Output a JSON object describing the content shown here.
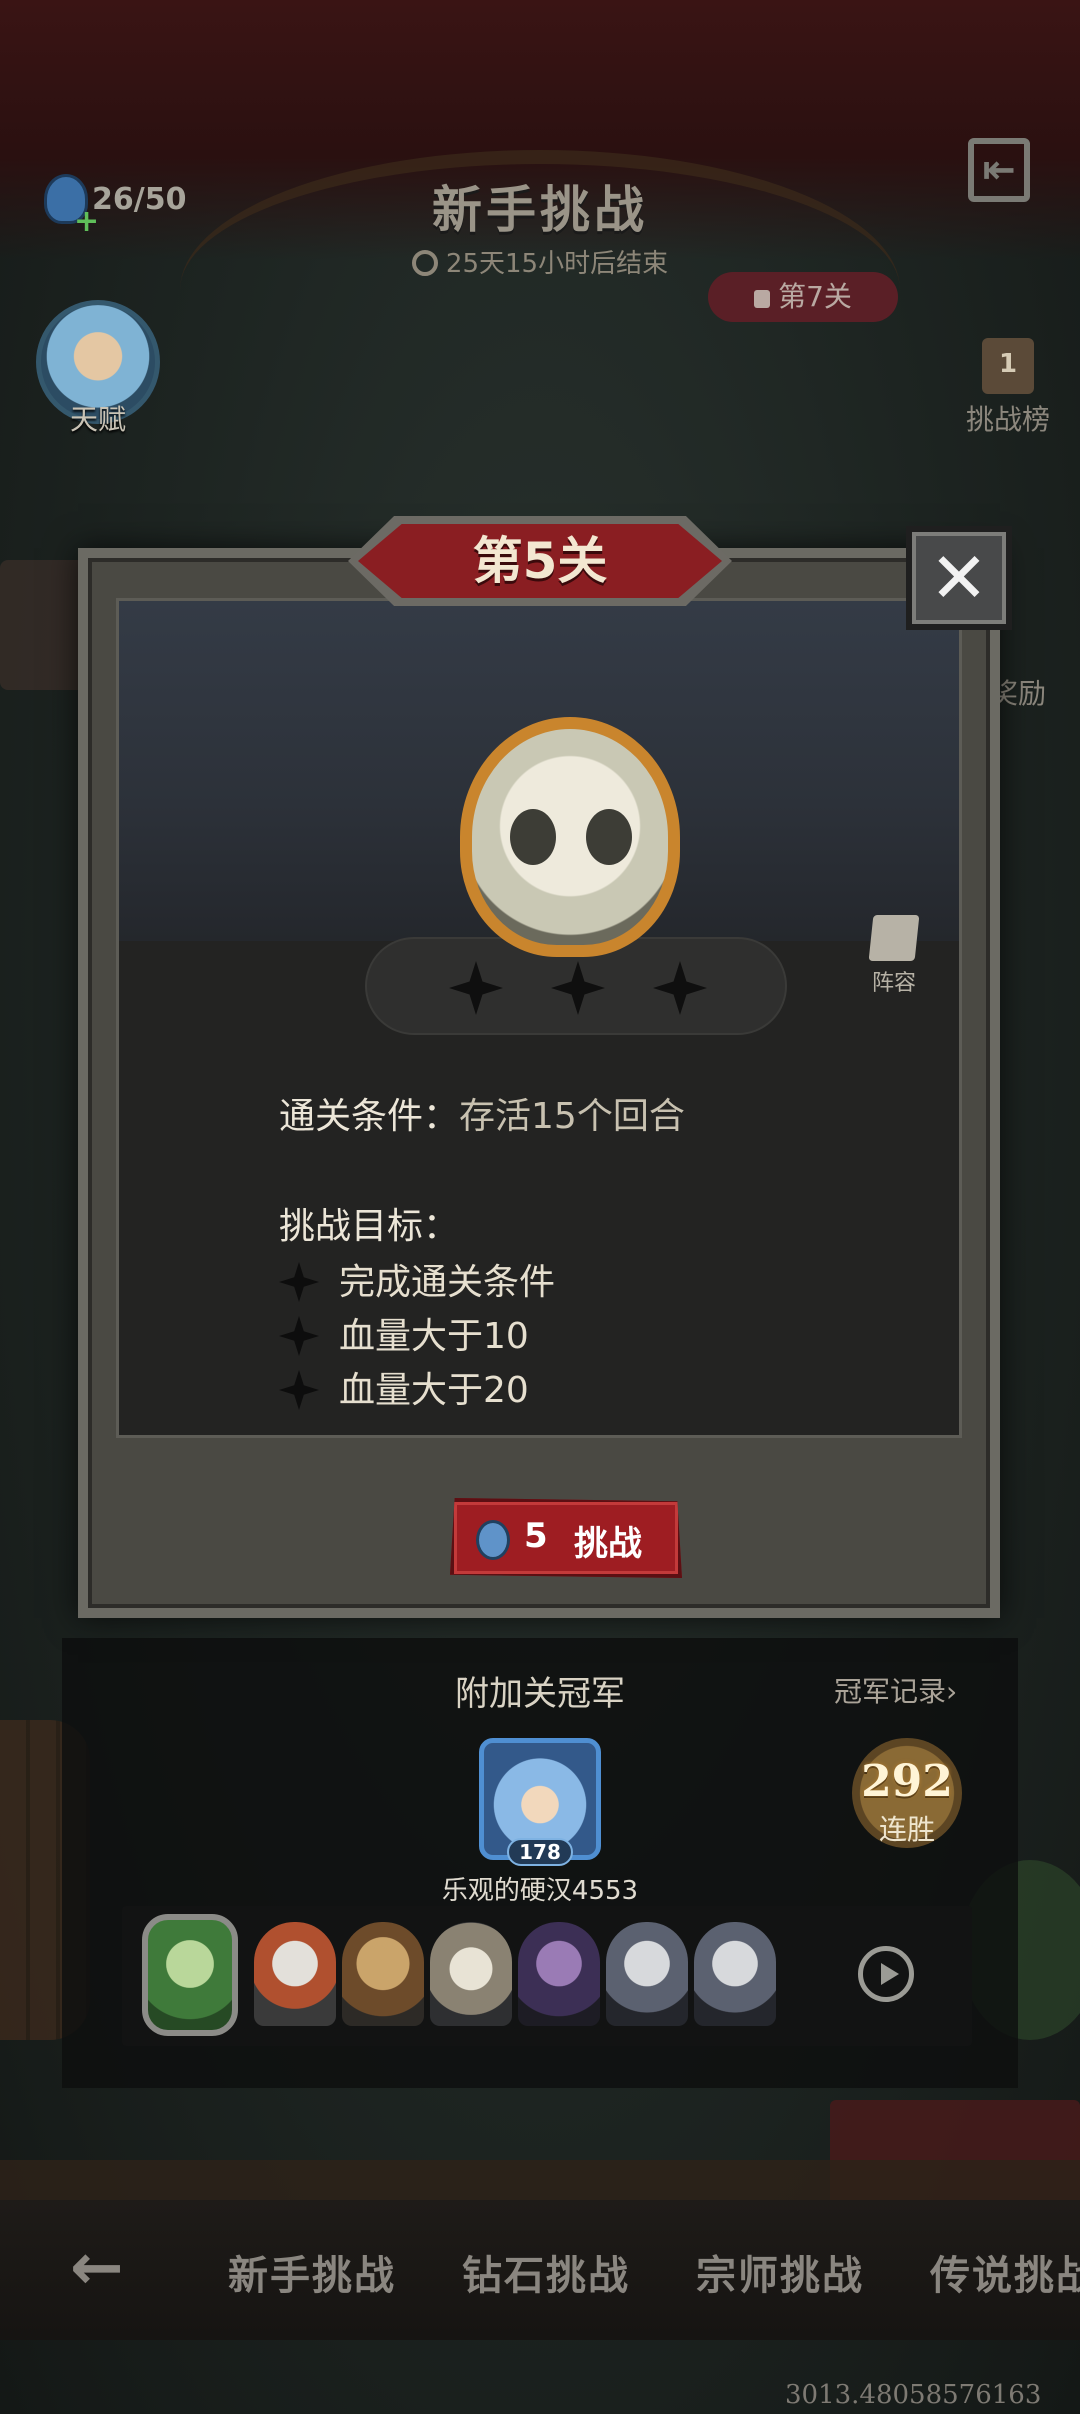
{
  "header": {
    "title": "新手挑战",
    "timer": "25天15小时后结束",
    "current_stage": "第7关"
  },
  "stamina": {
    "value": "26/50"
  },
  "sidebar": {
    "talent_label": "天赋",
    "rank_label": "挑战榜",
    "rank_badge": "1",
    "reward_label": "奖励"
  },
  "modal": {
    "stage_title": "第5关",
    "close_symbol": "✕",
    "stars_earned": 0,
    "stars_total": 3,
    "lineup_label": "阵容",
    "condition_label": "通关条件：",
    "condition_value": "存活15个回合",
    "goals_title": "挑战目标：",
    "goals": [
      "完成通关条件",
      "血量大于10",
      "血量大于20"
    ],
    "challenge_cost": "5",
    "challenge_label": "挑战"
  },
  "champion": {
    "title": "附加关冠军",
    "record_link": "冠军记录›",
    "level": "178",
    "name": "乐观的硬汉4553",
    "streak_value": "292",
    "streak_label": "连胜"
  },
  "bottom_nav": {
    "back_symbol": "←",
    "tabs": [
      "新手挑战",
      "钻石挑战",
      "宗师挑战",
      "传说挑战"
    ]
  },
  "debug_readout": "3013.48058576163",
  "colors": {
    "accent_red": "#9e1d22",
    "gold": "#c9852d",
    "text_light": "#ece6d8"
  }
}
